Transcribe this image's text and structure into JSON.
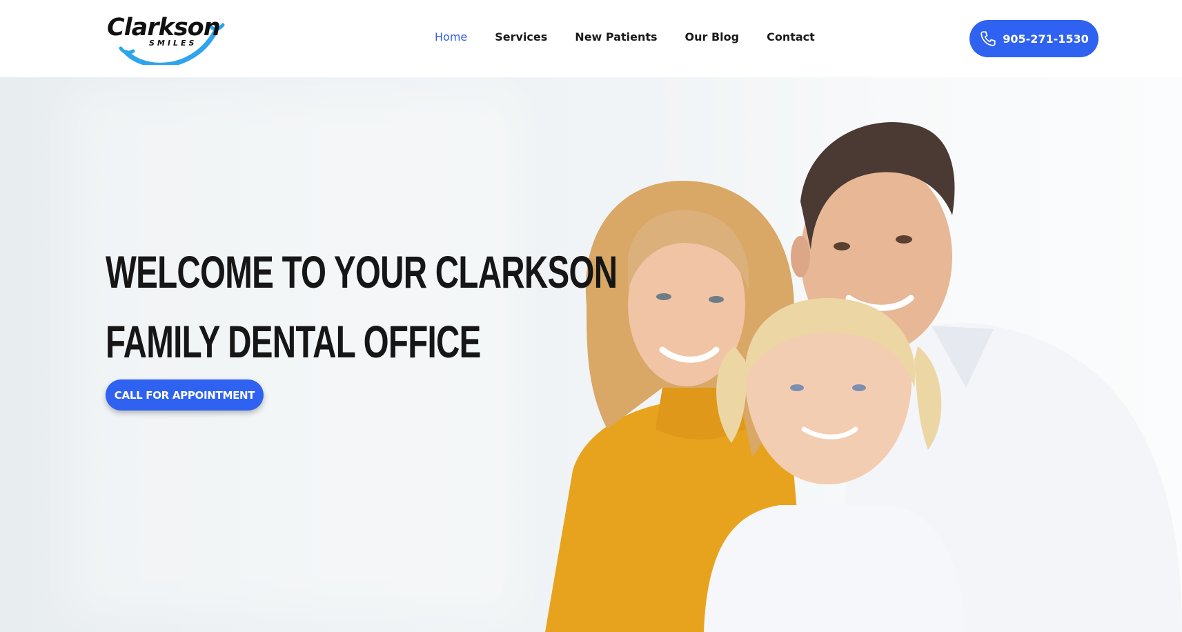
{
  "header": {
    "logo": {
      "word": "Clarkson",
      "sub": "SMILES"
    },
    "nav": [
      {
        "label": "Home",
        "active": true
      },
      {
        "label": "Services",
        "active": false
      },
      {
        "label": "New Patients",
        "active": false
      },
      {
        "label": "Our Blog",
        "active": false
      },
      {
        "label": "Contact",
        "active": false
      }
    ],
    "phone": {
      "label": "905-271-1530",
      "icon": "phone-icon"
    }
  },
  "hero": {
    "title_line1": "WELCOME TO YOUR CLARKSON",
    "title_line2": "FAMILY DENTAL OFFICE",
    "cta_label": "CALL FOR APPOINTMENT"
  },
  "colors": {
    "accent": "#2f62f0",
    "nav_active": "#2f5fe6",
    "logo_smile": "#2ea3ee",
    "sweater": "#e8a31e"
  }
}
